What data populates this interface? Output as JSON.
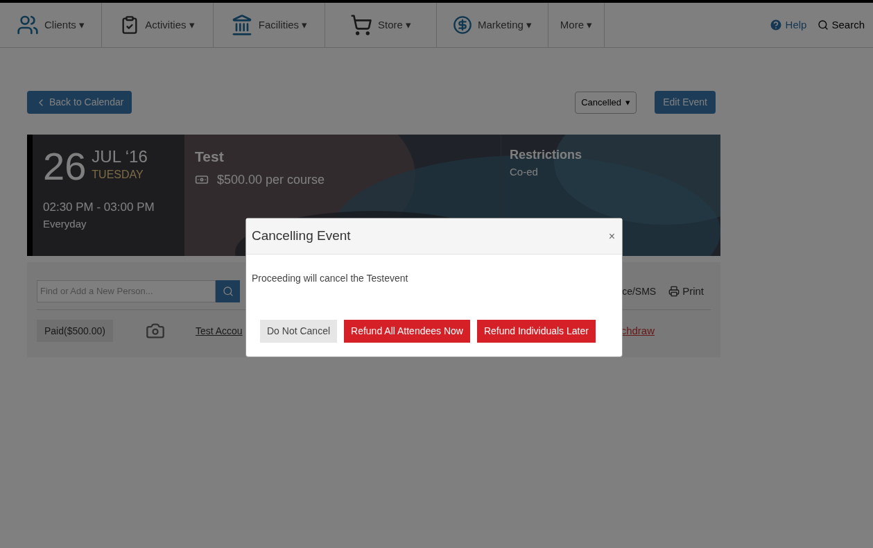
{
  "nav": {
    "items": [
      {
        "label": "Clients",
        "kind": "clients"
      },
      {
        "label": "Activities",
        "kind": "activities"
      },
      {
        "label": "Facilities",
        "kind": "facilities"
      },
      {
        "label": "Store",
        "kind": "store"
      },
      {
        "label": "Marketing",
        "kind": "marketing"
      },
      {
        "label": "More",
        "kind": "none"
      }
    ],
    "caret": "▾",
    "help": "Help",
    "search": "Search"
  },
  "toolbar": {
    "back": "Back to Calendar",
    "status": "Cancelled",
    "status_caret": "▾",
    "edit": "Edit Event"
  },
  "event": {
    "day": "26",
    "month": "JUL ‘16",
    "weekday": "TUESDAY",
    "time": "02:30 PM - 03:00 PM",
    "recurrence": "Everyday",
    "title": "Test",
    "price": "$500.00 per course",
    "restrictions_title": "Restrictions",
    "restrictions": "Co-ed"
  },
  "attendees": {
    "search_placeholder": "Find or Add a New Person...",
    "notify": "ce/SMS",
    "print": "Print",
    "row": {
      "paid": "Paid($500.00)",
      "name": "Test Accou",
      "withdraw": "chdraw"
    }
  },
  "modal": {
    "title": "Cancelling Event",
    "close": "×",
    "message": "Proceeding will cancel the Testevent",
    "buttons": [
      {
        "label": "Do Not Cancel",
        "kind": "default"
      },
      {
        "label": "Refund All Attendees Now",
        "kind": "danger"
      },
      {
        "label": "Refund Individuals Later",
        "kind": "danger"
      }
    ]
  }
}
